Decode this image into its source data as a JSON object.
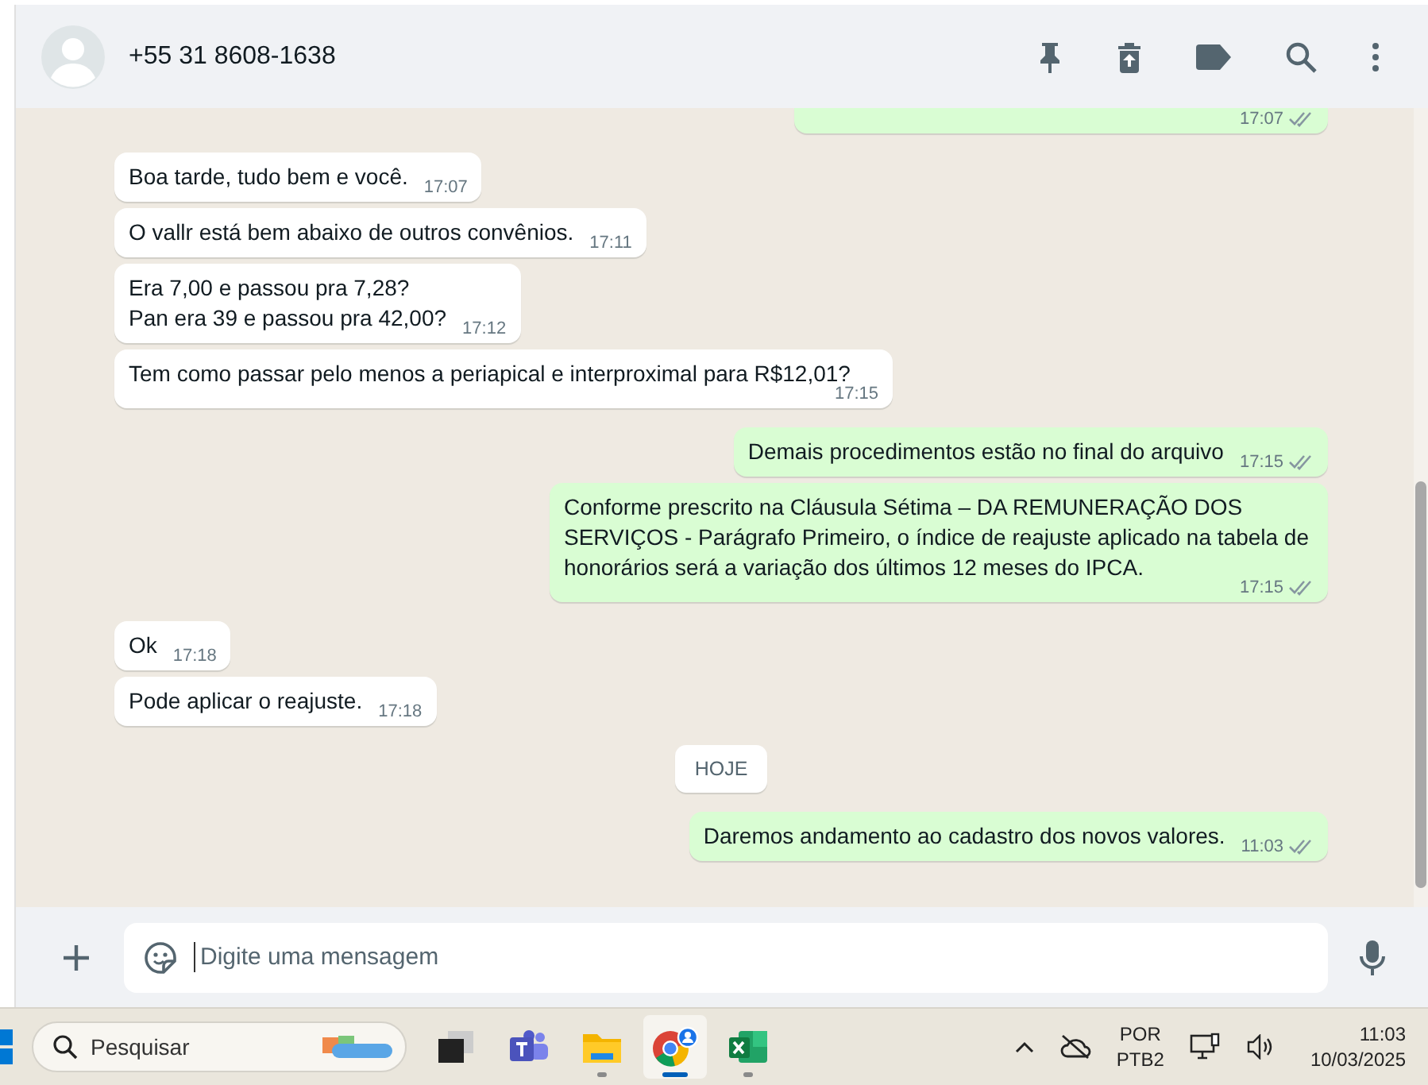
{
  "chat_header": {
    "contact": "+55 31 8608-1638"
  },
  "messages": [
    {
      "kind": "out",
      "time": "17:07"
    },
    {
      "kind": "in",
      "text": "Boa tarde, tudo bem e você.",
      "time": "17:07"
    },
    {
      "kind": "in",
      "text": "O vallr está bem abaixo de outros convênios.",
      "time": "17:11"
    },
    {
      "kind": "in",
      "text": "Era 7,00 e passou pra 7,28?\nPan era 39 e passou pra 42,00?",
      "time": "17:12"
    },
    {
      "kind": "in",
      "text": "Tem como passar pelo menos a  periapical e interproximal para R$12,01?",
      "time": "17:15"
    },
    {
      "kind": "out",
      "text": "Demais procedimentos estão no final do arquivo",
      "time": "17:15"
    },
    {
      "kind": "out",
      "text": "Conforme prescrito na Cláusula Sétima – DA REMUNERAÇÃO DOS SERVIÇOS - Parágrafo Primeiro, o índice de reajuste aplicado na tabela de honorários será a variação dos últimos 12 meses do IPCA.",
      "time": "17:15"
    },
    {
      "kind": "in",
      "text": "Ok",
      "time": "17:18"
    },
    {
      "kind": "in",
      "text": "Pode aplicar o reajuste.",
      "time": "17:18"
    },
    {
      "kind": "date",
      "text": "HOJE"
    },
    {
      "kind": "out",
      "text": "Daremos andamento ao cadastro dos novos valores.",
      "time": "11:03"
    }
  ],
  "composer": {
    "placeholder": "Digite uma mensagem"
  },
  "taskbar": {
    "search_placeholder": "Pesquisar",
    "apps": [
      {
        "kind": "task-view",
        "running": false,
        "active": false
      },
      {
        "kind": "teams",
        "running": false,
        "active": false
      },
      {
        "kind": "files",
        "running": true,
        "active": false
      },
      {
        "kind": "chrome",
        "running": true,
        "active": true
      },
      {
        "kind": "excel",
        "running": true,
        "active": false
      }
    ],
    "language": "POR",
    "layout": "PTB2",
    "time": "11:03",
    "date": "10/03/2025"
  }
}
